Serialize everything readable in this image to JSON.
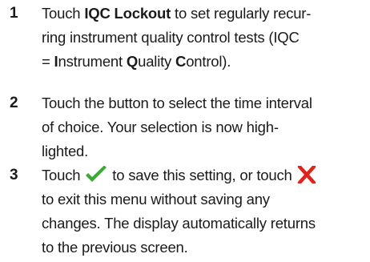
{
  "steps": [
    {
      "number": "1",
      "lines": [
        {
          "pre": "Touch ",
          "bold": "IQC Lockout",
          "post": " to set regularly recur-"
        },
        {
          "text": "ring instrument quality control tests (IQC"
        },
        {
          "parts": [
            "= ",
            "I",
            "nstrument ",
            "Q",
            "uality ",
            "C",
            "ontrol)."
          ]
        }
      ]
    },
    {
      "number": "2",
      "lines": [
        {
          "text": "Touch the button to select the time interval"
        },
        {
          "text": "of choice. Your selection is now high-"
        },
        {
          "text": "lighted."
        }
      ]
    },
    {
      "number": "3",
      "lines": [
        {
          "pre": "Touch ",
          "post": " to save this setting, or touch "
        },
        {
          "text": "to exit this menu without saving any"
        },
        {
          "text": "changes. The display automatically returns"
        },
        {
          "text": "to the previous screen."
        }
      ]
    }
  ],
  "icons": {
    "save": "checkmark-icon",
    "exit": "cross-icon"
  },
  "colors": {
    "checkmark": "#3aa935",
    "cross": "#e2231a",
    "text": "#1a1a1a"
  }
}
